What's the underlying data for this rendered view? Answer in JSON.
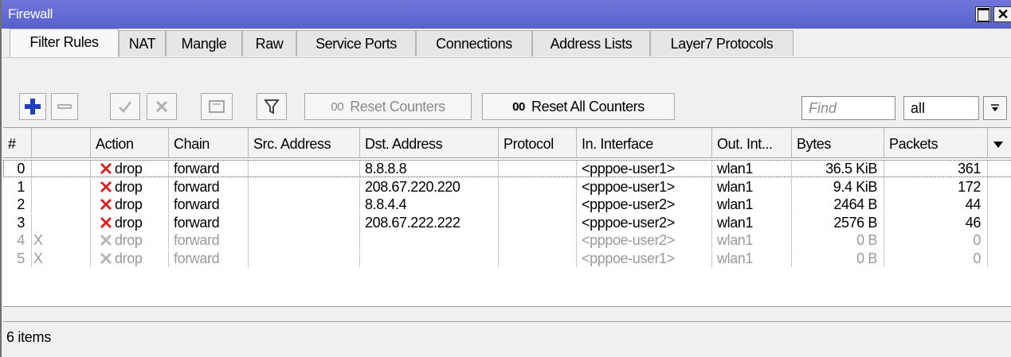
{
  "window": {
    "title": "Firewall"
  },
  "tabs": [
    {
      "label": "Filter Rules"
    },
    {
      "label": "NAT"
    },
    {
      "label": "Mangle"
    },
    {
      "label": "Raw"
    },
    {
      "label": "Service Ports"
    },
    {
      "label": "Connections"
    },
    {
      "label": "Address Lists"
    },
    {
      "label": "Layer7 Protocols"
    }
  ],
  "toolbar": {
    "reset_counters_label": "Reset Counters",
    "reset_counters_prefix": "00",
    "reset_all_counters_label": "Reset All Counters",
    "reset_all_counters_prefix": "00",
    "find_placeholder": "Find",
    "filter_value": "all"
  },
  "table": {
    "columns": [
      "#",
      "",
      "Action",
      "Chain",
      "Src. Address",
      "Dst. Address",
      "Protocol",
      "In. Interface",
      "Out. Int...",
      "Bytes",
      "Packets"
    ],
    "rows": [
      {
        "num": "0",
        "flag": "",
        "action": "drop",
        "chain": "forward",
        "src": "",
        "dst": "8.8.8.8",
        "protocol": "",
        "in_iface": "<pppoe-user1>",
        "out_iface": "wlan1",
        "bytes": "36.5 KiB",
        "packets": "361",
        "disabled": false
      },
      {
        "num": "1",
        "flag": "",
        "action": "drop",
        "chain": "forward",
        "src": "",
        "dst": "208.67.220.220",
        "protocol": "",
        "in_iface": "<pppoe-user1>",
        "out_iface": "wlan1",
        "bytes": "9.4 KiB",
        "packets": "172",
        "disabled": false
      },
      {
        "num": "2",
        "flag": "",
        "action": "drop",
        "chain": "forward",
        "src": "",
        "dst": "8.8.4.4",
        "protocol": "",
        "in_iface": "<pppoe-user2>",
        "out_iface": "wlan1",
        "bytes": "2464 B",
        "packets": "44",
        "disabled": false
      },
      {
        "num": "3",
        "flag": "",
        "action": "drop",
        "chain": "forward",
        "src": "",
        "dst": "208.67.222.222",
        "protocol": "",
        "in_iface": "<pppoe-user2>",
        "out_iface": "wlan1",
        "bytes": "2576 B",
        "packets": "46",
        "disabled": false
      },
      {
        "num": "4",
        "flag": "X",
        "action": "drop",
        "chain": "forward",
        "src": "",
        "dst": "",
        "protocol": "",
        "in_iface": "<pppoe-user2>",
        "out_iface": "wlan1",
        "bytes": "0 B",
        "packets": "0",
        "disabled": true
      },
      {
        "num": "5",
        "flag": "X",
        "action": "drop",
        "chain": "forward",
        "src": "",
        "dst": "",
        "protocol": "",
        "in_iface": "<pppoe-user1>",
        "out_iface": "wlan1",
        "bytes": "0 B",
        "packets": "0",
        "disabled": true
      }
    ]
  },
  "status": {
    "items_label": "6 items"
  },
  "colors": {
    "title_bar": "#5f67d3",
    "add_icon": "#1f3fbf",
    "drop_icon": "#d6201f"
  },
  "icons": [
    "add-icon",
    "remove-icon",
    "enable-icon",
    "disable-icon",
    "comment-icon",
    "filter-icon",
    "drop-icon",
    "dropdown-arrow-icon"
  ]
}
